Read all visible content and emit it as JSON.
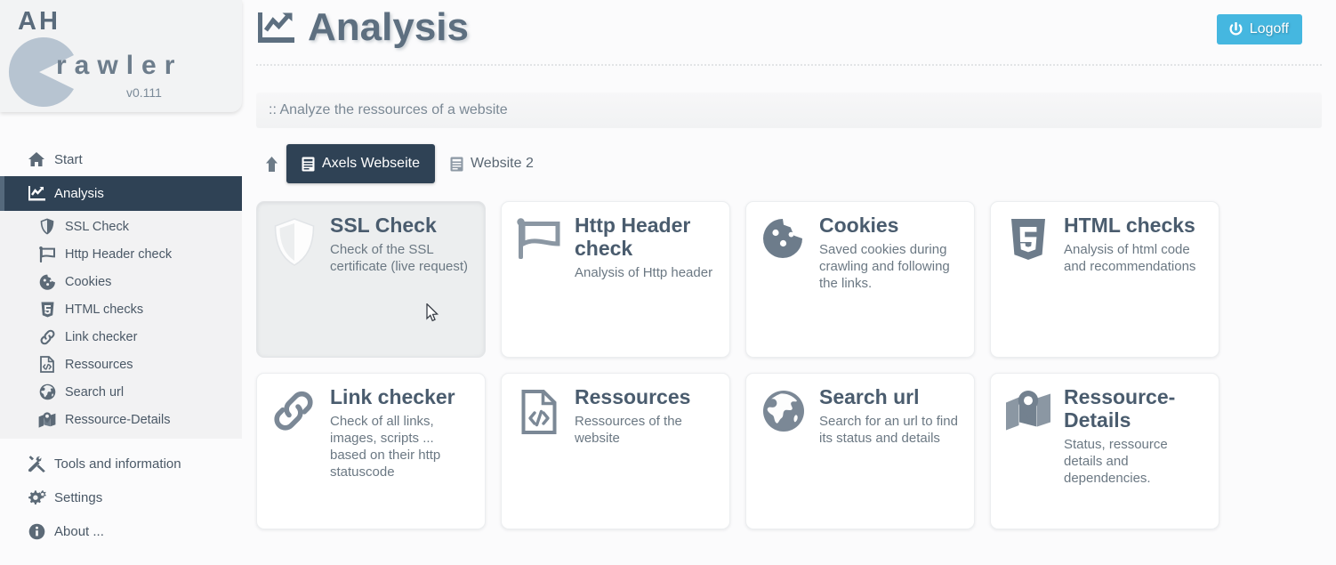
{
  "brand": {
    "prefix": "AH",
    "word": "rawler",
    "version": "v0.111",
    "logo_color": "#b7c4d1"
  },
  "header": {
    "title": "Analysis",
    "title_icon": "chart-line-icon",
    "subtitle": ":: Analyze the ressources of a website",
    "logoff_label": "Logoff",
    "logoff_icon": "power-icon",
    "accent_color": "#45b7e0"
  },
  "sidebar": {
    "items": [
      {
        "label": "Start",
        "icon": "home-icon",
        "active": false
      },
      {
        "label": "Analysis",
        "icon": "chart-line-icon",
        "active": true
      },
      {
        "label": "Tools and information",
        "icon": "tools-icon",
        "active": false
      },
      {
        "label": "Settings",
        "icon": "gears-icon",
        "active": false
      },
      {
        "label": "About ...",
        "icon": "info-icon",
        "active": false
      }
    ],
    "subitems": [
      {
        "label": "SSL Check",
        "icon": "shield-icon"
      },
      {
        "label": "Http Header check",
        "icon": "flag-icon"
      },
      {
        "label": "Cookies",
        "icon": "cookie-icon"
      },
      {
        "label": "HTML checks",
        "icon": "html5-icon"
      },
      {
        "label": "Link checker",
        "icon": "link-icon"
      },
      {
        "label": "Ressources",
        "icon": "file-code-icon"
      },
      {
        "label": "Search url",
        "icon": "globe-icon"
      },
      {
        "label": "Ressource-Details",
        "icon": "map-pin-icon"
      }
    ],
    "active_color": "#2f4255"
  },
  "tabs": {
    "scroll_icon": "arrow-up-icon",
    "items": [
      {
        "label": "Axels Webseite",
        "icon": "website-icon",
        "active": true
      },
      {
        "label": "Website 2",
        "icon": "website-icon",
        "active": false
      }
    ]
  },
  "cards": [
    {
      "title": "SSL Check",
      "desc": "Check of the SSL certificate (live request)",
      "icon": "shield-icon",
      "hover": true
    },
    {
      "title": "Http Header check",
      "desc": "Analysis of Http header",
      "icon": "flag-icon",
      "hover": false
    },
    {
      "title": "Cookies",
      "desc": "Saved cookies during crawling and following the links.",
      "icon": "cookie-icon",
      "hover": false
    },
    {
      "title": "HTML checks",
      "desc": "Analysis of html code and recommendations",
      "icon": "html5-icon",
      "hover": false
    },
    {
      "title": "Link checker",
      "desc": "Check of all links, images, scripts ... based on their http statuscode",
      "icon": "link-icon",
      "hover": false
    },
    {
      "title": "Ressources",
      "desc": "Ressources of the website",
      "icon": "file-code-icon",
      "hover": false
    },
    {
      "title": "Search url",
      "desc": "Search for an url to find its status and details",
      "icon": "globe-icon",
      "hover": false
    },
    {
      "title": "Ressource-Details",
      "desc": "Status, ressource details and dependencies.",
      "icon": "map-pin-icon",
      "hover": false
    }
  ]
}
